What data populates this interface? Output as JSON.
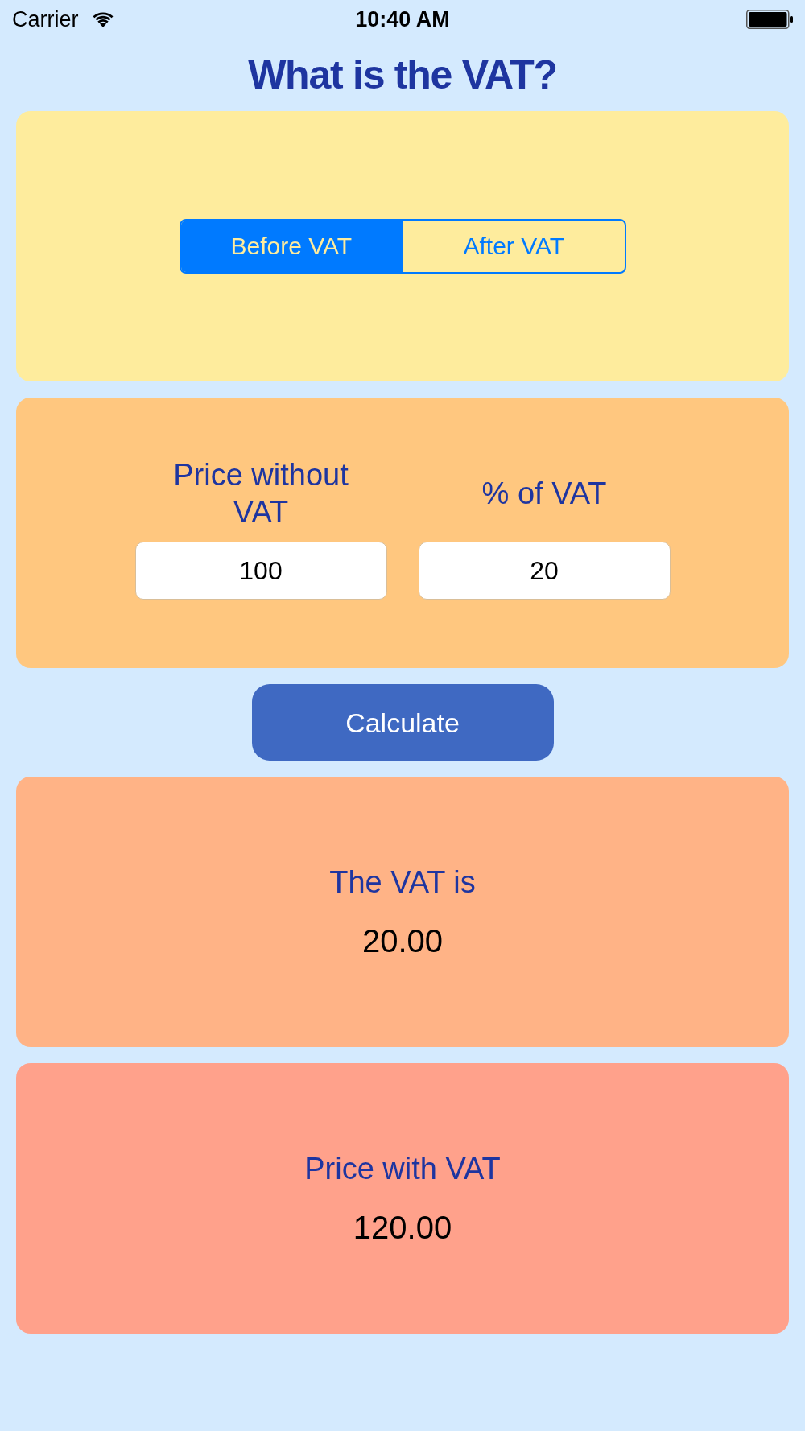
{
  "status_bar": {
    "carrier": "Carrier",
    "time": "10:40 AM"
  },
  "title": "What is the VAT?",
  "mode_selector": {
    "segments": [
      {
        "label": "Before VAT",
        "selected": true
      },
      {
        "label": "After VAT",
        "selected": false
      }
    ]
  },
  "inputs": [
    {
      "label": "Price without VAT",
      "value": "100"
    },
    {
      "label": "% of VAT",
      "value": "20"
    }
  ],
  "calculate_button": {
    "label": "Calculate"
  },
  "results": [
    {
      "label": "The VAT is",
      "value": "20.00"
    },
    {
      "label": "Price with VAT",
      "value": "120.00"
    }
  ]
}
